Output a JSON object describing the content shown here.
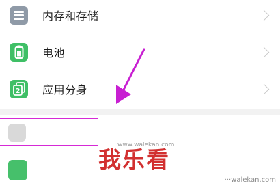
{
  "settings": {
    "items": [
      {
        "label": "内存和存储",
        "icon": "storage-icon",
        "color": "#8f9aa7"
      },
      {
        "label": "电池",
        "icon": "battery-icon",
        "color": "#3fbf66"
      },
      {
        "label": "应用分身",
        "icon": "app-clone-icon",
        "color": "#3fbf66"
      }
    ]
  },
  "watermark": {
    "brand": "我乐看",
    "url": "www.walekan.com",
    "corner": "···walekan.com"
  },
  "colors": {
    "arrow": "#c81fd2",
    "highlight": "#d62ad6",
    "watermark": "#d23030"
  }
}
